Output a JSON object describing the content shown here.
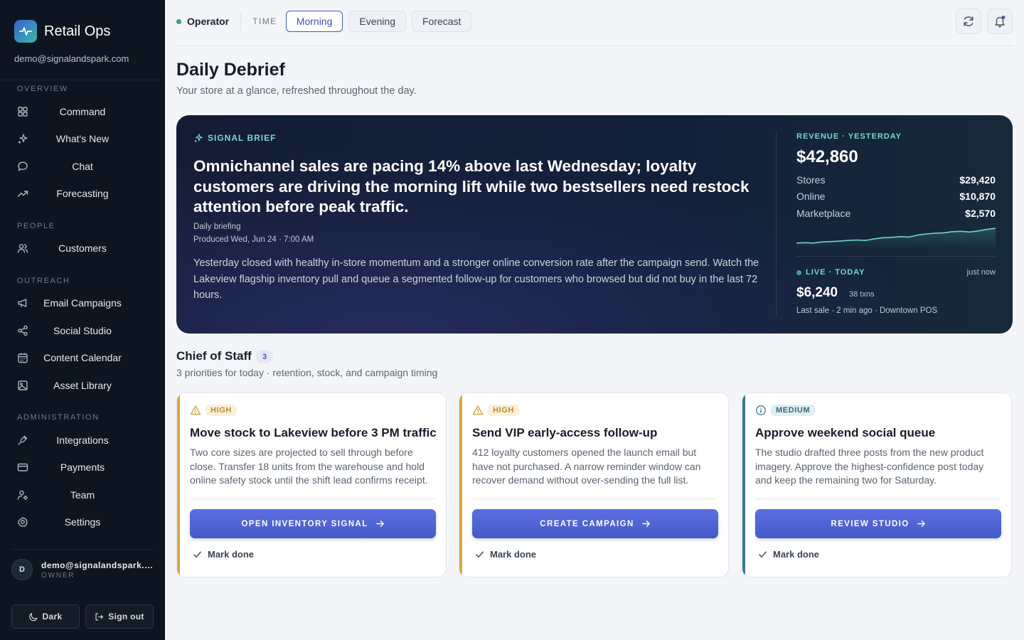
{
  "sidebar": {
    "brand": "Retail Ops",
    "email": "demo@signalandspark.com",
    "sections": {
      "overview": "OVERVIEW",
      "people": "PEOPLE",
      "outreach": "OUTREACH",
      "administration": "ADMINISTRATION"
    },
    "items": [
      {
        "label": "Command",
        "icon": "grid-icon"
      },
      {
        "label": "What's New",
        "icon": "sparkle-icon"
      },
      {
        "label": "Chat",
        "icon": "chat-bubble-icon"
      },
      {
        "label": "Forecasting",
        "icon": "trend-up-icon"
      },
      {
        "label": "Customers",
        "icon": "users-icon"
      },
      {
        "label": "Email Campaigns",
        "icon": "megaphone-icon"
      },
      {
        "label": "Social Studio",
        "icon": "share-icon"
      },
      {
        "label": "Content Calendar",
        "icon": "calendar-icon"
      },
      {
        "label": "Asset Library",
        "icon": "image-icon"
      },
      {
        "label": "Integrations",
        "icon": "plug-icon"
      },
      {
        "label": "Payments",
        "icon": "credit-card-icon"
      },
      {
        "label": "Team",
        "icon": "user-gear-icon"
      },
      {
        "label": "Settings",
        "icon": "gear-icon"
      }
    ],
    "user": {
      "initial": "D",
      "email": "demo@signalandspark.com",
      "role": "OWNER"
    },
    "dark_label": "Dark",
    "signout_label": "Sign out"
  },
  "topbar": {
    "operator": "Operator",
    "time_label": "TIME",
    "tabs": [
      "Morning",
      "Evening",
      "Forecast"
    ],
    "active_tab": "Morning"
  },
  "header": {
    "title": "Daily Debrief",
    "subtitle": "Your store at a glance, refreshed throughout the day."
  },
  "hero": {
    "tag": "SIGNAL BRIEF",
    "headline": "Omnichannel sales are pacing 14% above last Wednesday; loyalty customers are driving the morning lift while two bestsellers need restock attention before peak traffic.",
    "meta_type": "Daily briefing",
    "meta_produced": "Produced Wed, Jun 24 · 7:00 AM",
    "body": "Yesterday closed with healthy in-store momentum and a stronger online conversion rate after the campaign send. Watch the Lakeview flagship inventory pull and queue a segmented follow-up for customers who browsed but did not buy in the last 72 hours.",
    "revenue": {
      "label": "REVENUE · YESTERDAY",
      "total": "$42,860",
      "rows": [
        {
          "label": "Stores",
          "value": "$29,420"
        },
        {
          "label": "Online",
          "value": "$10,870"
        },
        {
          "label": "Marketplace",
          "value": "$2,570"
        }
      ],
      "sparkline": [
        3,
        3.5,
        3,
        4.5,
        5,
        5.5,
        6.5,
        7,
        6.5,
        8.5,
        10,
        10.5,
        11.5,
        11,
        13.5,
        15,
        16,
        16.5,
        18,
        18.5,
        17.5,
        19,
        21,
        22.5
      ]
    },
    "live": {
      "label": "LIVE · TODAY",
      "time": "just now",
      "amount": "$6,240",
      "txns": "38 txns",
      "last_sale": "Last sale · 2 min ago · Downtown POS"
    }
  },
  "chief_of_staff": {
    "title": "Chief of Staff",
    "count": "3",
    "subtitle": "3 priorities for today · retention, stock, and campaign timing",
    "cards": [
      {
        "priority": "HIGH",
        "priority_icon": "warning-triangle-icon",
        "accent": "#d9a545",
        "badge_bg": "#fbf0dc",
        "badge_fg": "#c58a24",
        "title": "Move stock to Lakeview before 3 PM traffic",
        "body": "Two core sizes are projected to sell through before close. Transfer 18 units from the warehouse and hold online safety stock until the shift lead confirms receipt.",
        "button": "OPEN INVENTORY SIGNAL",
        "mark_done": "Mark done"
      },
      {
        "priority": "HIGH",
        "priority_icon": "warning-triangle-icon",
        "accent": "#d9a545",
        "badge_bg": "#fbf0dc",
        "badge_fg": "#c58a24",
        "title": "Send VIP early-access follow-up",
        "body": "412 loyalty customers opened the launch email but have not purchased. A narrow reminder window can recover demand without over-sending the full list.",
        "button": "CREATE CAMPAIGN",
        "mark_done": "Mark done"
      },
      {
        "priority": "MEDIUM",
        "priority_icon": "info-circle-icon",
        "accent": "#3a7a8e",
        "badge_bg": "#e1eef2",
        "badge_fg": "#2f6b7d",
        "title": "Approve weekend social queue",
        "body": "The studio drafted three posts from the new product imagery. Approve the highest-confidence post today and keep the remaining two for Saturday.",
        "button": "REVIEW STUDIO",
        "mark_done": "Mark done"
      }
    ]
  }
}
